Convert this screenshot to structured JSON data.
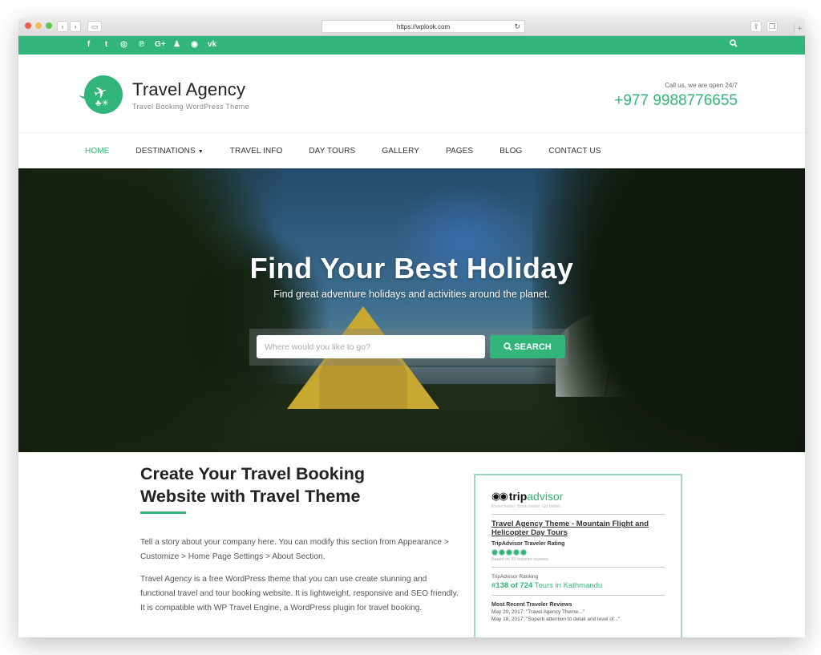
{
  "browser": {
    "url": "https://wplook.com",
    "traffic_colors": [
      "#ed5f56",
      "#f4bd4f",
      "#5fc454"
    ]
  },
  "topbar": {
    "social_icons": [
      {
        "name": "facebook-icon",
        "glyph": "f"
      },
      {
        "name": "twitter-icon",
        "glyph": "t"
      },
      {
        "name": "instagram-icon",
        "glyph": "◎"
      },
      {
        "name": "pinterest-icon",
        "glyph": "℗"
      },
      {
        "name": "google-plus-icon",
        "glyph": "G+"
      },
      {
        "name": "snapchat-icon",
        "glyph": "♟"
      },
      {
        "name": "weibo-icon",
        "glyph": "◉"
      },
      {
        "name": "vk-icon",
        "glyph": "vk"
      }
    ],
    "search_glyph": "🔍︎"
  },
  "header": {
    "logo_title": "Travel Agency",
    "logo_subtitle": "Travel Booking WordPress Theme",
    "contact_label": "Call us, we are open 24/7",
    "contact_phone": "+977 9988776655"
  },
  "nav": {
    "items": [
      {
        "label": "HOME",
        "active": true
      },
      {
        "label": "DESTINATIONS",
        "dropdown": true
      },
      {
        "label": "TRAVEL INFO"
      },
      {
        "label": "DAY TOURS"
      },
      {
        "label": "GALLERY"
      },
      {
        "label": "PAGES"
      },
      {
        "label": "BLOG"
      },
      {
        "label": "CONTACT US"
      }
    ]
  },
  "hero": {
    "title": "Find Your Best Holiday",
    "subtitle": "Find great adventure holidays and activities around the planet.",
    "search_placeholder": "Where would you like to go?",
    "search_button": "SEARCH"
  },
  "about": {
    "title": "Create Your Travel Booking Website with Travel Theme",
    "paragraph1": "Tell a story about your company here. You can modify this section from Appearance > Customize > Home Page Settings > About Section.",
    "paragraph2": "Travel Agency is a free WordPress theme that you can use create stunning and functional travel and tour booking website. It is lightweight, responsive and SEO friendly. It is compatible with WP Travel Engine, a WordPress plugin for travel booking."
  },
  "tripadvisor": {
    "brand_trip": "trip",
    "brand_advisor": "advisor",
    "tagline": "Know better. Book better. Go better.",
    "listing_title": "Travel Agency Theme - Mountain Flight and Helicopter Day Tours",
    "rating_label": "TripAdvisor Traveler Rating",
    "rating_bubbles": 5,
    "rating_based_on": "Based on 50 traveler reviews",
    "ranking_label": "TripAdvisor Ranking",
    "ranking_position": "#138 of 724",
    "ranking_suffix": "Tours in Kathmandu",
    "reviews_label": "Most Recent Traveler Reviews",
    "reviews": [
      "May 20, 2017: \"Travel Agency Theme...\"",
      "May 18, 2017: \"Superb attention to detail and level of...\""
    ]
  }
}
